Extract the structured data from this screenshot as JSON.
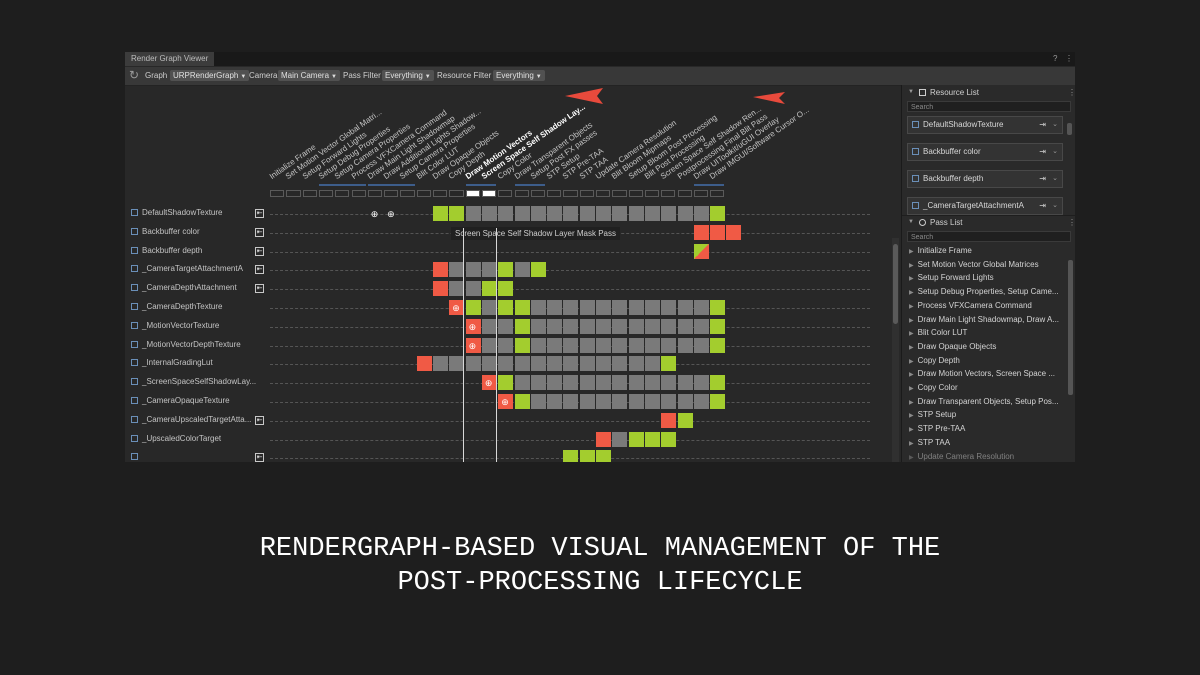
{
  "window": {
    "title": "Render Graph Viewer"
  },
  "toolbar": {
    "graph_label": "Graph",
    "graph_value": "URPRenderGraph",
    "camera_label": "Camera",
    "camera_value": "Main Camera",
    "pass_filter_label": "Pass Filter",
    "pass_filter_value": "Everything",
    "resource_filter_label": "Resource Filter",
    "resource_filter_value": "Everything"
  },
  "passes": [
    {
      "label": "Initialize Frame"
    },
    {
      "label": "Set Motion Vector Global Matri..."
    },
    {
      "label": "Setup Forward Lights"
    },
    {
      "label": "Setup Debug Properties"
    },
    {
      "label": "Setup Camera Properties"
    },
    {
      "label": "Process VFXCamera Command"
    },
    {
      "label": "Draw Main Light Shadowmap"
    },
    {
      "label": "Draw Additional Lights Shadow..."
    },
    {
      "label": "Setup Camera Properties"
    },
    {
      "label": "Blit Color LUT"
    },
    {
      "label": "Draw Opaque Objects"
    },
    {
      "label": "Copy Depth"
    },
    {
      "label": "Draw Motion Vectors",
      "bold": true
    },
    {
      "label": "Screen Space Self Shadow Lay...",
      "bold": true
    },
    {
      "label": "Copy Color"
    },
    {
      "label": "Draw Transparent Objects"
    },
    {
      "label": "Setup Post FX passes"
    },
    {
      "label": "STP Setup"
    },
    {
      "label": "STP Pre-TAA"
    },
    {
      "label": "STP TAA"
    },
    {
      "label": "Update Camera Resolution"
    },
    {
      "label": "Blit Bloom Mipmaps"
    },
    {
      "label": "Setup Bloom Post Processing"
    },
    {
      "label": "Blit Post Processing"
    },
    {
      "label": "Screen Space Self Shadow Ren..."
    },
    {
      "label": "Postprocessing Final Blit Pass"
    },
    {
      "label": "Draw UIToolkit/uGUI Overlay"
    },
    {
      "label": "Draw IMGUI/Software Cursor O..."
    }
  ],
  "tooltip": "Screen Space Self Shadow Layer Mask Pass",
  "resources": [
    {
      "name": "DefaultShadowTexture",
      "imported": true,
      "cells": "..........ggyyyyyyyyyyyyyyyg..",
      "globes": [
        6,
        7
      ]
    },
    {
      "name": "Backbuffer color",
      "imported": true,
      "cells": "..........................rrr"
    },
    {
      "name": "Backbuffer depth",
      "imported": true,
      "cells": "..........................m.."
    },
    {
      "name": "_CameraTargetAttachmentA",
      "imported": true,
      "cells": "..........ryyygyg.............."
    },
    {
      "name": "_CameraDepthAttachment",
      "imported": true,
      "cells": "..........ryygg.................."
    },
    {
      "name": "_CameraDepthTexture",
      "imported": false,
      "cells": "...........rgyggyyyyyyyyyyyg..",
      "globes": [
        11
      ]
    },
    {
      "name": "_MotionVectorTexture",
      "imported": false,
      "cells": "............ryygyyyyyyyyyyyg..",
      "globes": [
        12
      ]
    },
    {
      "name": "_MotionVectorDepthTexture",
      "imported": false,
      "cells": "............ryygyyyyyyyyyyyg..",
      "globes": [
        12
      ]
    },
    {
      "name": "_InternalGradingLut",
      "imported": false,
      "cells": ".........ryyyyyyyyyyyyyyg......"
    },
    {
      "name": "_ScreenSpaceSelfShadowLay...",
      "imported": false,
      "cells": ".............rgyyyyyyyyyyyyg..",
      "globes": [
        13
      ]
    },
    {
      "name": "_CameraOpaqueTexture",
      "imported": false,
      "cells": "..............rgyyyyyyyyyyyg..",
      "globes": [
        14
      ]
    },
    {
      "name": "_CameraUpscaledTargetAtta...",
      "imported": true,
      "cells": "........................rg......"
    },
    {
      "name": "_UpscaledColorTarget",
      "imported": false,
      "cells": "....................ryggg......."
    },
    {
      "name": "",
      "imported": true,
      "cells": "..................ggg..........."
    }
  ],
  "resource_list": {
    "title": "Resource List",
    "search_placeholder": "Search",
    "items": [
      "DefaultShadowTexture",
      "Backbuffer color",
      "Backbuffer depth",
      "_CameraTargetAttachmentA"
    ]
  },
  "pass_list": {
    "title": "Pass List",
    "search_placeholder": "Search",
    "items": [
      "Initialize Frame",
      "Set Motion Vector Global Matrices",
      "Setup Forward Lights",
      "Setup Debug Properties, Setup Came...",
      "Process VFXCamera Command",
      "Draw Main Light Shadowmap, Draw A...",
      "Blit Color LUT",
      "Draw Opaque Objects",
      "Copy Depth",
      "Draw Motion Vectors, Screen Space ...",
      "Copy Color",
      "Draw Transparent Objects, Setup Pos...",
      "STP Setup",
      "STP Pre-TAA",
      "STP TAA",
      "Update Camera Resolution"
    ]
  },
  "caption": {
    "line1": "RENDERGRAPH-BASED VISUAL MANAGEMENT OF THE",
    "line2": "POST-PROCESSING LIFECYCLE"
  },
  "colors": {
    "write": "#a3cd2e",
    "read": "#f05a45",
    "lifetime": "#7a7a7a",
    "accent": "#e84a3c"
  }
}
